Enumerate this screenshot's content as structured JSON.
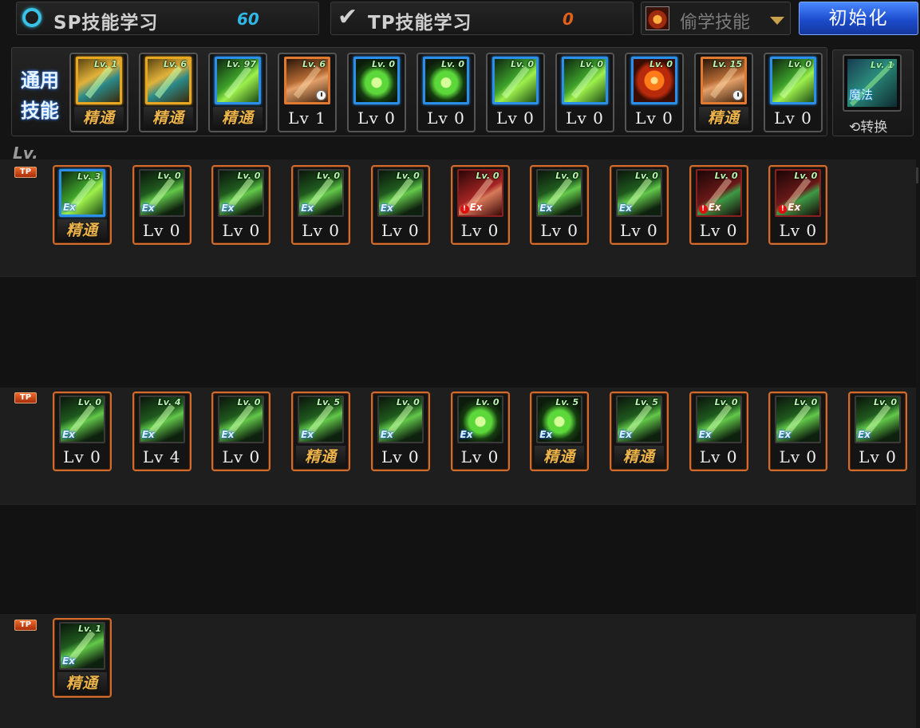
{
  "header": {
    "sp": {
      "label": "SP技能学习",
      "value": "60",
      "value_color": "#2fb8e6"
    },
    "tp": {
      "label": "TP技能学习",
      "value": "0",
      "value_color": "#e3601c"
    },
    "steal": {
      "label": "偷学技能"
    },
    "reset": {
      "label": "初始化"
    }
  },
  "general": {
    "label": "通用技能",
    "switch_label": "转换",
    "switch_icon": {
      "badge": "Lv. 1",
      "text": "魔法"
    },
    "skills": [
      {
        "badge": "Lv. 1",
        "label": "精通",
        "label_type": "master",
        "frame": "gold",
        "art": "gold"
      },
      {
        "badge": "Lv. 6",
        "label": "精通",
        "label_type": "master",
        "frame": "gold",
        "art": "gold"
      },
      {
        "badge": "Lv. 97",
        "label": "精通",
        "label_type": "master",
        "frame": "blue",
        "art": "green"
      },
      {
        "badge": "Lv. 6",
        "label": "Lv 1",
        "label_type": "level",
        "frame": "orange",
        "art": "brown",
        "clock": true
      },
      {
        "badge": "Lv. 0",
        "label": "Lv 0",
        "label_type": "level",
        "frame": "blue",
        "art": "greenbright"
      },
      {
        "badge": "Lv. 0",
        "label": "Lv 0",
        "label_type": "level",
        "frame": "blue",
        "art": "greenbright"
      },
      {
        "badge": "Lv. 0",
        "label": "Lv 0",
        "label_type": "level",
        "frame": "blue",
        "art": "green"
      },
      {
        "badge": "Lv. 0",
        "label": "Lv 0",
        "label_type": "level",
        "frame": "blue",
        "art": "green"
      },
      {
        "badge": "Lv. 0",
        "label": "Lv 0",
        "label_type": "level",
        "frame": "blue",
        "art": "fire"
      },
      {
        "badge": "Lv. 15",
        "label": "精通",
        "label_type": "master",
        "frame": "orange",
        "art": "brown",
        "clock": true
      },
      {
        "badge": "Lv. 0",
        "label": "Lv 0",
        "label_type": "level",
        "frame": "blue",
        "art": "green"
      }
    ]
  },
  "lv_header": "Lv.",
  "tp_tag": "TP",
  "rows": [
    {
      "skills": [
        {
          "badge": "Lv. 3",
          "label": "精通",
          "label_type": "master",
          "frame": "blue",
          "art": "green",
          "ex": "ex"
        },
        {
          "badge": "Lv. 0",
          "label": "Lv 0",
          "label_type": "level",
          "frame": "none",
          "art": "darkgreen",
          "ex": "ex"
        },
        {
          "badge": "Lv. 0",
          "label": "Lv 0",
          "label_type": "level",
          "frame": "none",
          "art": "darkgreen",
          "ex": "ex"
        },
        {
          "badge": "Lv. 0",
          "label": "Lv 0",
          "label_type": "level",
          "frame": "none",
          "art": "darkgreen",
          "ex": "ex"
        },
        {
          "badge": "Lv. 0",
          "label": "Lv 0",
          "label_type": "level",
          "frame": "none",
          "art": "darkgreen",
          "ex": "ex"
        },
        {
          "badge": "Lv. 0",
          "label": "Lv 0",
          "label_type": "level",
          "frame": "red",
          "art": "red",
          "ex": "exr"
        },
        {
          "badge": "Lv. 0",
          "label": "Lv 0",
          "label_type": "level",
          "frame": "none",
          "art": "darkgreen",
          "ex": "ex"
        },
        {
          "badge": "Lv. 0",
          "label": "Lv 0",
          "label_type": "level",
          "frame": "none",
          "art": "darkgreen",
          "ex": "ex"
        },
        {
          "badge": "Lv. 0",
          "label": "Lv 0",
          "label_type": "level",
          "frame": "red",
          "art": "darkred",
          "ex": "exr"
        },
        {
          "badge": "Lv. 0",
          "label": "Lv 0",
          "label_type": "level",
          "frame": "red",
          "art": "darkred",
          "ex": "exr"
        }
      ]
    },
    {
      "skills": [
        {
          "badge": "Lv. 0",
          "label": "Lv 0",
          "label_type": "level",
          "frame": "none",
          "art": "darkgreen",
          "ex": "ex"
        },
        {
          "badge": "Lv. 4",
          "label": "Lv 4",
          "label_type": "level",
          "frame": "none",
          "art": "darkgreen",
          "ex": "ex"
        },
        {
          "badge": "Lv. 0",
          "label": "Lv 0",
          "label_type": "level",
          "frame": "none",
          "art": "darkgreen",
          "ex": "ex"
        },
        {
          "badge": "Lv. 5",
          "label": "精通",
          "label_type": "master",
          "frame": "none",
          "art": "darkgreen",
          "ex": "ex"
        },
        {
          "badge": "Lv. 0",
          "label": "Lv 0",
          "label_type": "level",
          "frame": "none",
          "art": "darkgreen",
          "ex": "ex"
        },
        {
          "badge": "Lv. 0",
          "label": "Lv 0",
          "label_type": "level",
          "frame": "none",
          "art": "greenbright",
          "ex": "ex"
        },
        {
          "badge": "Lv. 5",
          "label": "精通",
          "label_type": "master",
          "frame": "none",
          "art": "greenbright",
          "ex": "ex"
        },
        {
          "badge": "Lv. 5",
          "label": "精通",
          "label_type": "master",
          "frame": "none",
          "art": "darkgreen",
          "ex": "ex"
        },
        {
          "badge": "Lv. 0",
          "label": "Lv 0",
          "label_type": "level",
          "frame": "none",
          "art": "darkgreen",
          "ex": "ex"
        },
        {
          "badge": "Lv. 0",
          "label": "Lv 0",
          "label_type": "level",
          "frame": "none",
          "art": "darkgreen",
          "ex": "ex"
        },
        {
          "badge": "Lv. 0",
          "label": "Lv 0",
          "label_type": "level",
          "frame": "none",
          "art": "darkgreen",
          "ex": "ex"
        }
      ]
    },
    {
      "skills": [
        {
          "badge": "Lv. 1",
          "label": "精通",
          "label_type": "master",
          "frame": "none",
          "art": "darkgreen",
          "ex": "ex"
        }
      ]
    }
  ],
  "ex_text": "Ex"
}
